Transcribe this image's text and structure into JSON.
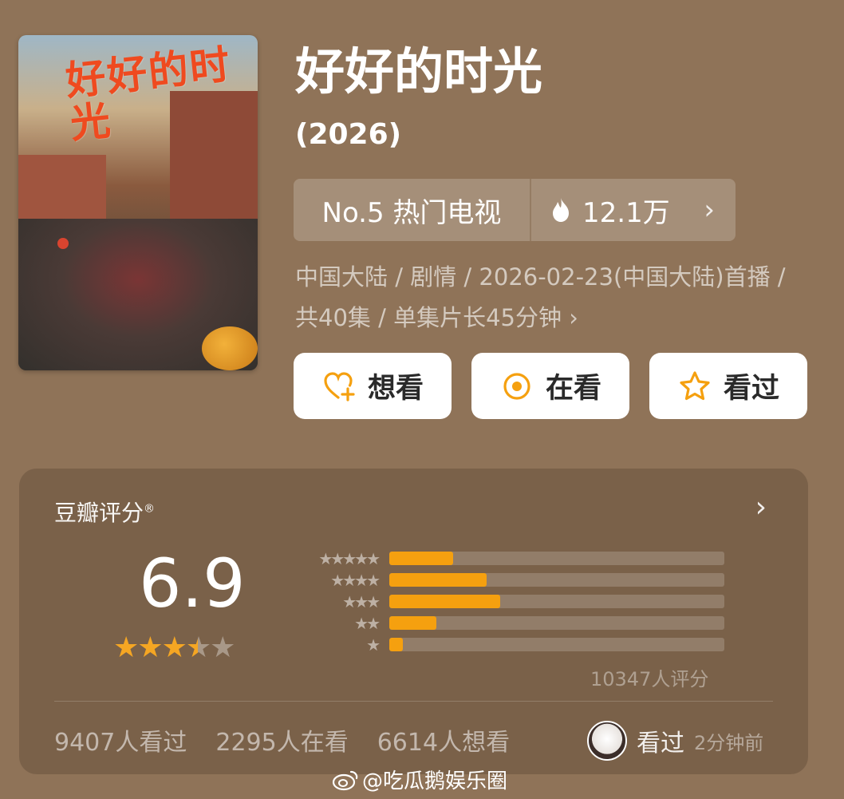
{
  "poster": {
    "title_art": "好好的时光"
  },
  "header": {
    "title": "好好的时光",
    "year": "(2026)"
  },
  "rank": {
    "label": "No.5 热门电视",
    "hot_count": "12.1万"
  },
  "meta": {
    "text": "中国大陆 / 剧情 / 2026-02-23(中国大陆)首播 / 共40集 / 单集片长45分钟"
  },
  "actions": {
    "want": "想看",
    "watching": "在看",
    "watched": "看过"
  },
  "rating": {
    "heading": "豆瓣评分",
    "reg_mark": "®",
    "score": "6.9",
    "stars_value": 3.5,
    "distribution": [
      {
        "stars": 5,
        "fraction": 0.19
      },
      {
        "stars": 4,
        "fraction": 0.29
      },
      {
        "stars": 3,
        "fraction": 0.33
      },
      {
        "stars": 2,
        "fraction": 0.14
      },
      {
        "stars": 1,
        "fraction": 0.04
      }
    ],
    "count": "10347人评分"
  },
  "stats": {
    "watched": "9407人看过",
    "watching": "2295人在看",
    "want": "6614人想看"
  },
  "friend": {
    "label": "看过",
    "time": "2分钟前"
  },
  "watermark": "@吃瓜鹅娱乐圈",
  "colors": {
    "accent": "#f5a00f",
    "background": "#8f7358",
    "button_bg": "#ffffff"
  }
}
